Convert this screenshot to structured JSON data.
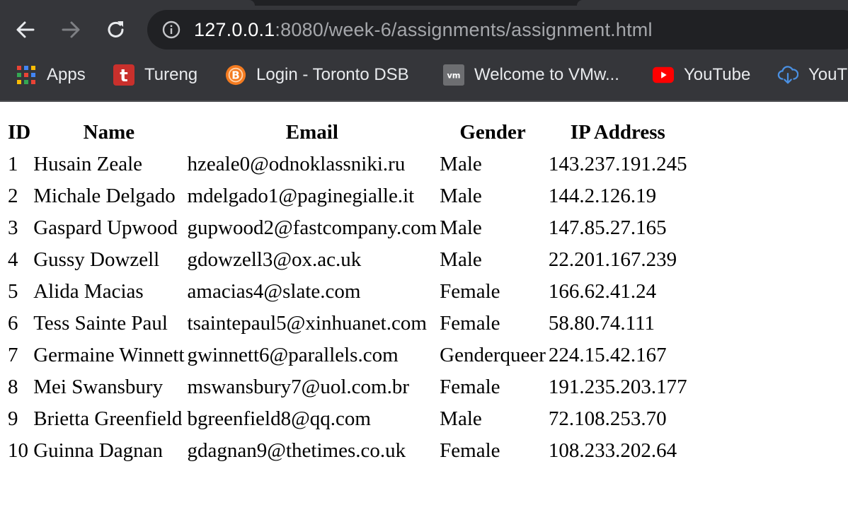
{
  "browser": {
    "url_host": "127.0.0.1",
    "url_rest": ":8080/week-6/assignments/assignment.html",
    "bookmarks": [
      {
        "label": "Apps",
        "icon": "apps-grid-icon"
      },
      {
        "label": "Tureng",
        "icon": "tureng-icon"
      },
      {
        "label": "Login - Toronto DSB",
        "icon": "brightspace-icon"
      },
      {
        "label": "Welcome to VMw...",
        "icon": "vmware-icon"
      },
      {
        "label": "YouTube",
        "icon": "youtube-icon"
      },
      {
        "label": "YouT",
        "icon": "cloud-download-icon"
      }
    ]
  },
  "table": {
    "headers": [
      "ID",
      "Name",
      "Email",
      "Gender",
      "IP Address"
    ],
    "rows": [
      [
        "1",
        "Husain Zeale",
        "hzeale0@odnoklassniki.ru",
        "Male",
        "143.237.191.245"
      ],
      [
        "2",
        "Michale Delgado",
        "mdelgado1@paginegialle.it",
        "Male",
        "144.2.126.19"
      ],
      [
        "3",
        "Gaspard Upwood",
        "gupwood2@fastcompany.com",
        "Male",
        "147.85.27.165"
      ],
      [
        "4",
        "Gussy Dowzell",
        "gdowzell3@ox.ac.uk",
        "Male",
        "22.201.167.239"
      ],
      [
        "5",
        "Alida Macias",
        "amacias4@slate.com",
        "Female",
        "166.62.41.24"
      ],
      [
        "6",
        "Tess Sainte Paul",
        "tsaintepaul5@xinhuanet.com",
        "Female",
        "58.80.74.111"
      ],
      [
        "7",
        "Germaine Winnett",
        "gwinnett6@parallels.com",
        "Genderqueer",
        "224.15.42.167"
      ],
      [
        "8",
        "Mei Swansbury",
        "mswansbury7@uol.com.br",
        "Female",
        "191.235.203.177"
      ],
      [
        "9",
        "Brietta Greenfield",
        "bgreenfield8@qq.com",
        "Male",
        "72.108.253.70"
      ],
      [
        "10",
        "Guinna Dagnan",
        "gdagnan9@thetimes.co.uk",
        "Female",
        "108.233.202.64"
      ]
    ]
  }
}
